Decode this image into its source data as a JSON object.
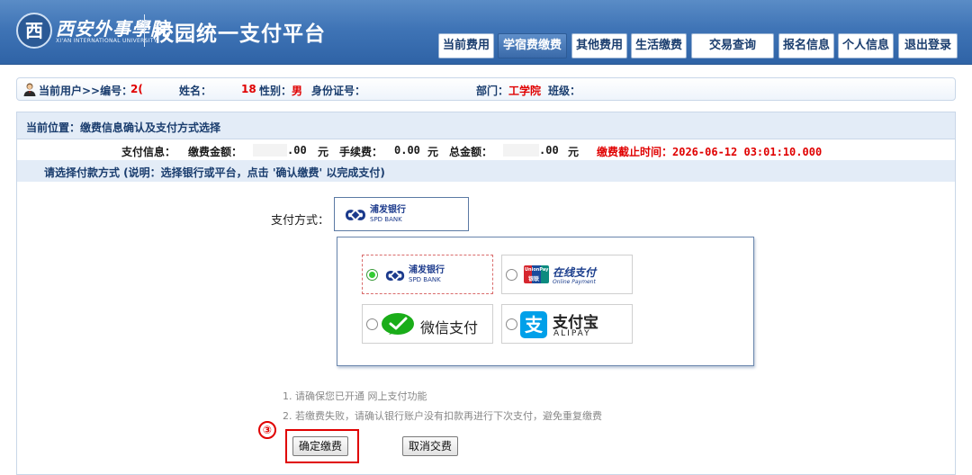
{
  "header": {
    "logo_glyph": "西",
    "school_name": "西安外事學院",
    "school_sub": "XI'AN INTERNATIONAL UNIVERSITY",
    "platform_title": "校园统一支付平台",
    "nav": [
      "当前费用",
      "学宿费缴费",
      "其他费用",
      "生活缴费",
      "交易查询",
      "报名信息",
      "个人信息",
      "退出登录"
    ],
    "active_nav": "学宿费缴费"
  },
  "userbar": {
    "current_user_label": "当前用户>>编号：",
    "id_value": "2(",
    "name_label": "姓名：",
    "name_value": "18",
    "gender_label": "性别：",
    "gender_value": "男",
    "idcard_label": "身份证号：",
    "dept_label": "部门：",
    "dept_value": "工学院",
    "class_label": "班级："
  },
  "location": "当前位置：缴费信息确认及支付方式选择",
  "payinfo": {
    "label": "支付信息：",
    "amount_label": "缴费金额：",
    "amount_value": ".00",
    "unit1": "元",
    "fee_label": "手续费：",
    "fee_value": "0.00",
    "unit2": "元",
    "total_label": "总金额：",
    "total_value": ".00",
    "unit3": "元",
    "deadline": "缴费截止时间：2026-06-12 03:01:10.000"
  },
  "method_hint": "请选择付款方式 (说明：选择银行或平台，点击 '确认缴费' 以完成支付)",
  "pay_method_label": "支付方式：",
  "spd": {
    "cn": "浦发银行",
    "en": "SPD BANK"
  },
  "options": {
    "unionpay_cn": "在线支付",
    "unionpay_en": "Online Payment",
    "unionpay_logo": "UnionPay",
    "unionpay_logo_cn": "银联",
    "wechat": "微信支付",
    "alipay_cn": "支付宝",
    "alipay_en": "ALIPAY",
    "alipay_glyph": "支"
  },
  "notes": [
    "1. 请确保您已开通 网上支付功能",
    "2. 若缴费失败，请确认银行账户没有扣款再进行下次支付，避免重复缴费"
  ],
  "step_mark": "③",
  "buttons": {
    "confirm": "确定缴费",
    "cancel": "取消交费"
  },
  "colors": {
    "header": "#3f74b6",
    "highlight": "#e00000",
    "radio_selected": "#33cc33"
  }
}
